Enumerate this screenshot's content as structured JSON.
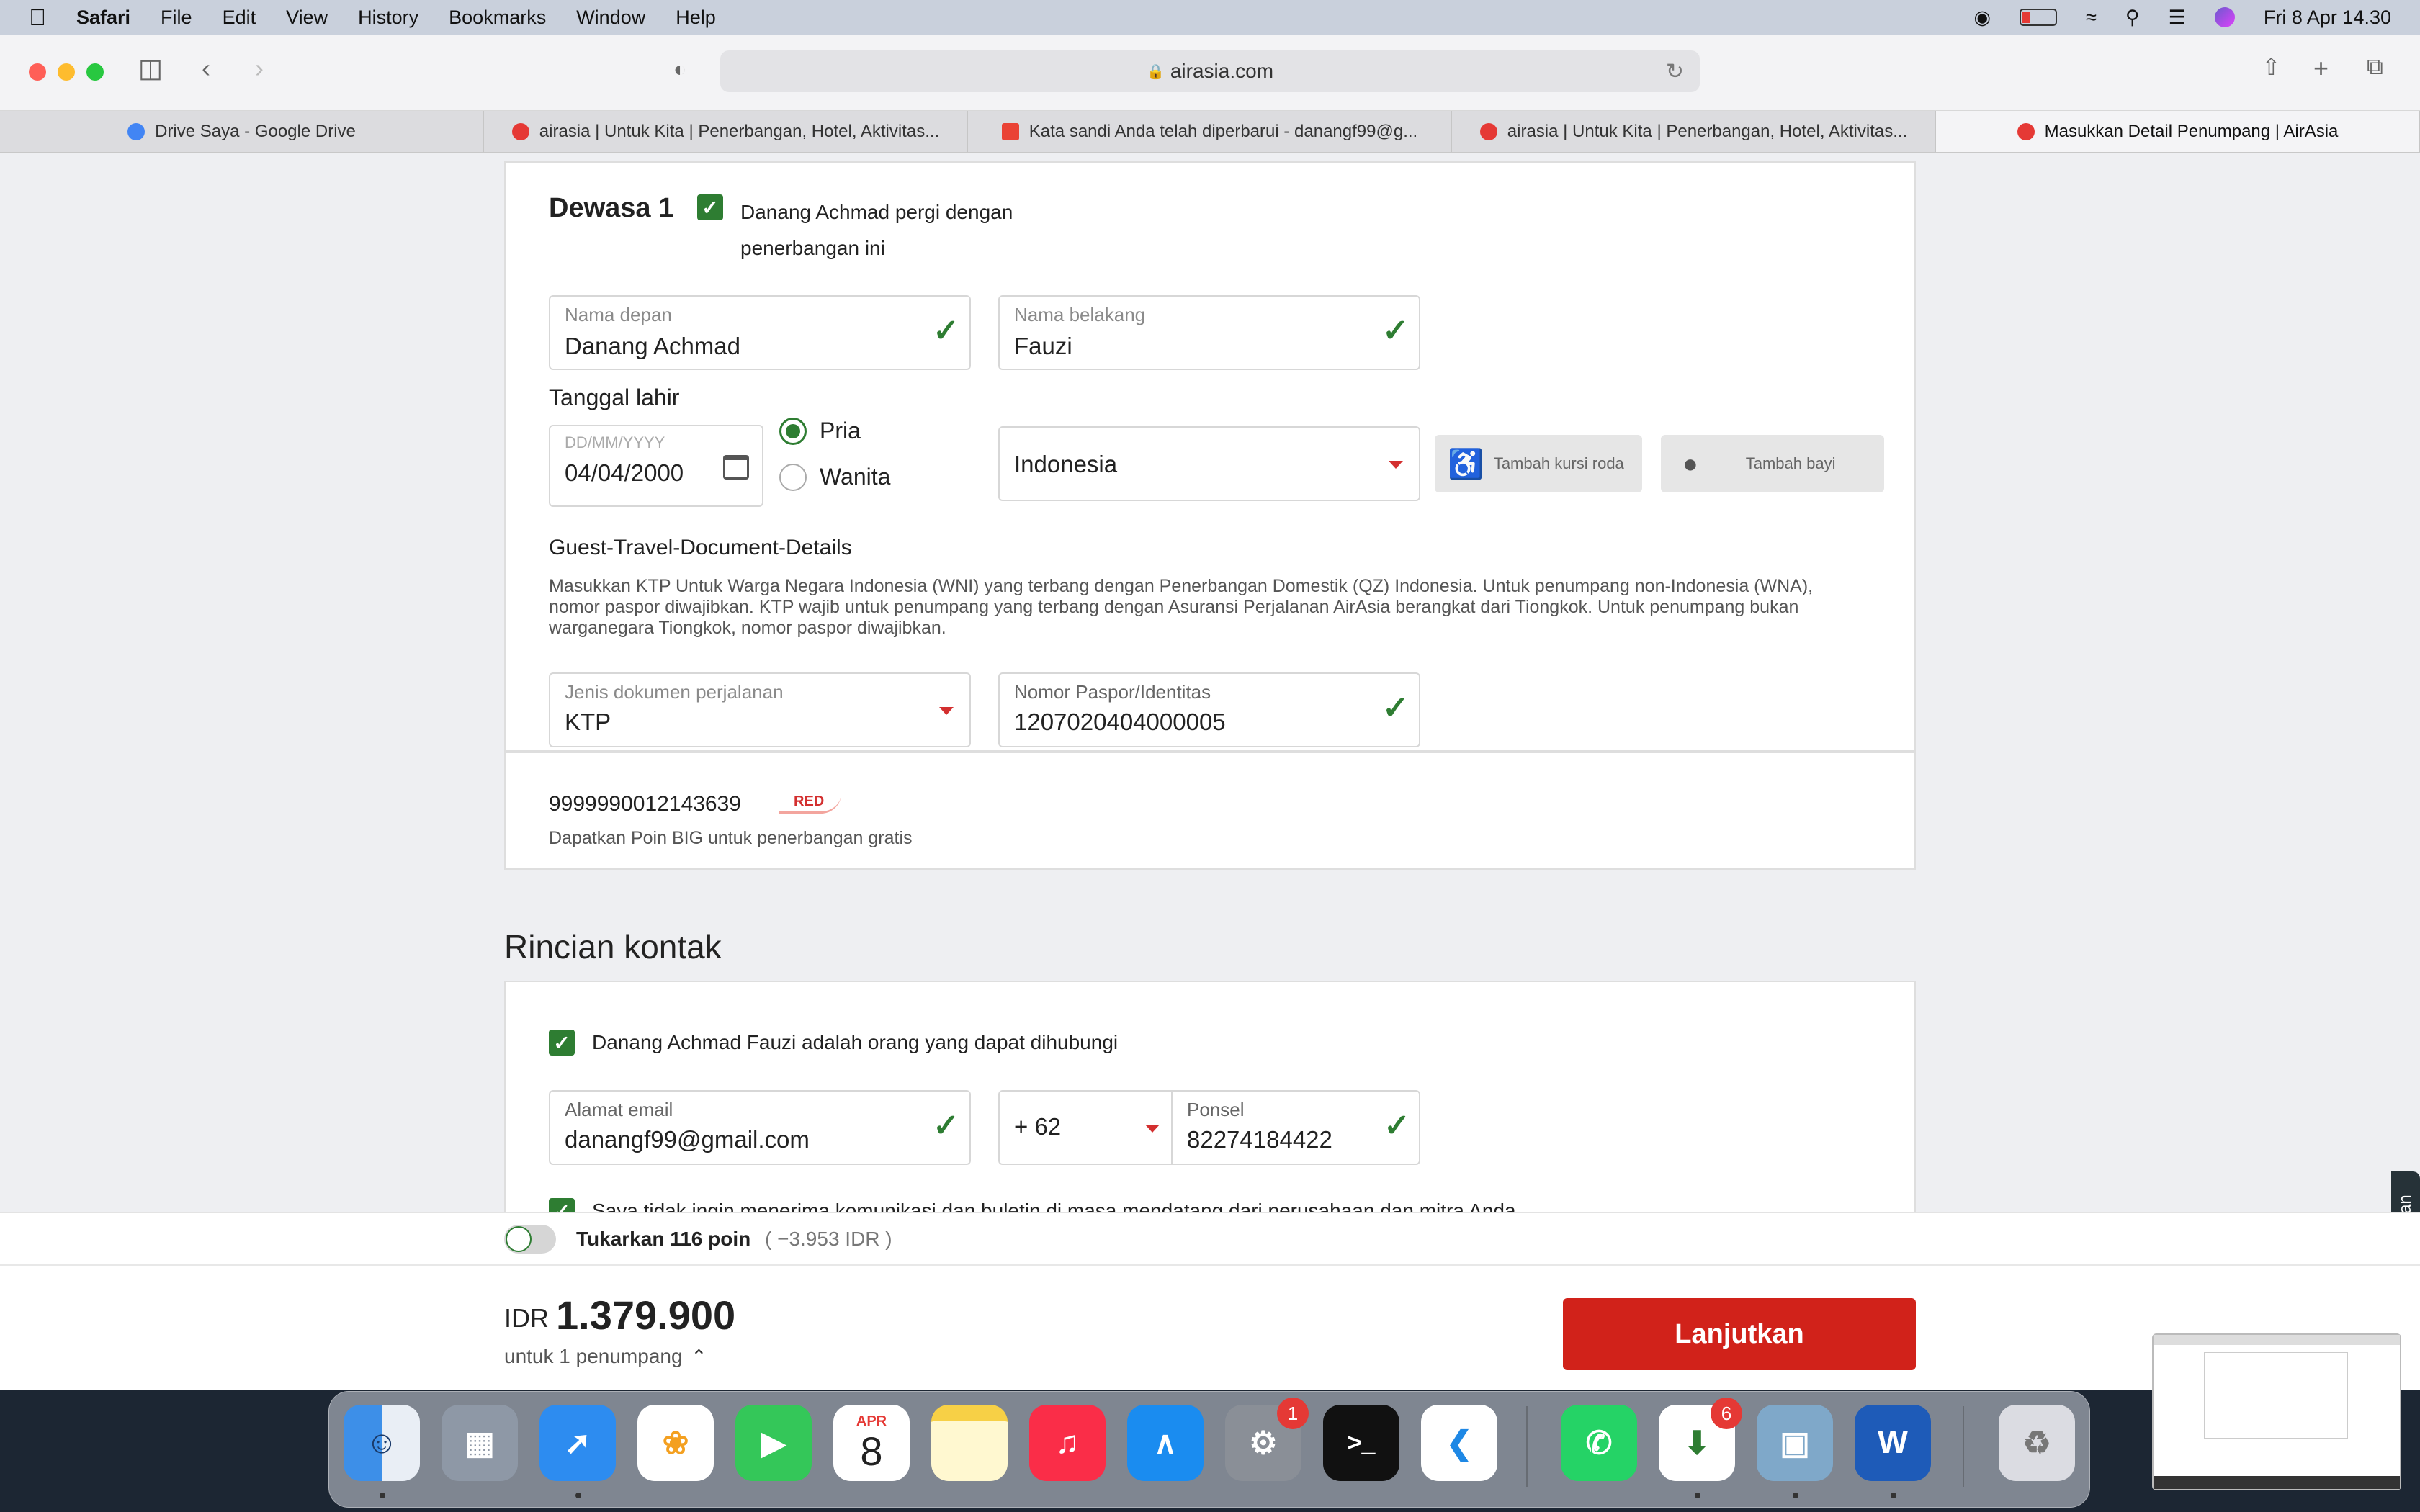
{
  "menubar": {
    "app": "Safari",
    "items": [
      "File",
      "Edit",
      "View",
      "History",
      "Bookmarks",
      "Window",
      "Help"
    ],
    "clock": "Fri 8 Apr  14.30"
  },
  "browser": {
    "url": "airasia.com",
    "tabs": [
      {
        "title": "Drive Saya - Google Drive",
        "color": "#4285f4"
      },
      {
        "title": "airasia | Untuk Kita | Penerbangan, Hotel, Aktivitas...",
        "color": "#e53935"
      },
      {
        "title": "Kata sandi Anda telah diperbarui - danangf99@g...",
        "color": "#ea4335"
      },
      {
        "title": "airasia | Untuk Kita | Penerbangan, Hotel, Aktivitas...",
        "color": "#e53935"
      },
      {
        "title": "Masukkan Detail Penumpang | AirAsia",
        "color": "#e53935"
      }
    ]
  },
  "passenger": {
    "heading": "Dewasa 1",
    "traveling_label_1": "Danang Achmad pergi dengan",
    "traveling_label_2": "penerbangan ini",
    "first_name_label": "Nama depan",
    "first_name": "Danang Achmad",
    "last_name_label": "Nama belakang",
    "last_name": "Fauzi",
    "dob_heading": "Tanggal lahir",
    "dob_placeholder": "DD/MM/YYYY",
    "dob": "04/04/2000",
    "gender_male": "Pria",
    "gender_female": "Wanita",
    "nationality": "Indonesia",
    "wheelchair_button": "Tambah kursi roda",
    "infant_button": "Tambah bayi",
    "doc_heading": "Guest-Travel-Document-Details",
    "doc_note": "Masukkan KTP Untuk Warga Negara Indonesia (WNI) yang terbang dengan Penerbangan Domestik (QZ) Indonesia. Untuk penumpang non-Indonesia (WNA), nomor paspor diwajibkan. KTP wajib untuk penumpang yang terbang dengan Asuransi Perjalanan AirAsia berangkat dari Tiongkok. Untuk penumpang bukan warganegara Tiongkok, nomor paspor diwajibkan.",
    "doc_type_label": "Jenis dokumen perjalanan",
    "doc_type": "KTP",
    "doc_number_label": "Nomor Paspor/Identitas",
    "doc_number": "1207020404000005",
    "member_id": "9999990012143639",
    "member_tier": "RED",
    "member_note": "Dapatkan Poin BIG untuk penerbangan gratis"
  },
  "contact": {
    "heading": "Rincian kontak",
    "contact_person": "Danang Achmad Fauzi adalah orang yang dapat dihubungi",
    "email_label": "Alamat email",
    "email": "danangf99@gmail.com",
    "country_code": "+ 62",
    "phone_label": "Ponsel",
    "phone": "82274184422",
    "optout": "Saya tidak ingin menerima komunikasi dan buletin di masa mendatang dari perusahaan dan mitra Anda"
  },
  "feedback_tab": "Tanggapan",
  "booking": {
    "points_label": "Tukarkan 116 poin",
    "points_value": "( −3.953 IDR )",
    "currency": "IDR",
    "price": "1.379.900",
    "per_pax": "untuk 1 penumpang",
    "cta": "Lanjutkan"
  },
  "dock": {
    "calendar_month": "APR",
    "calendar_day": "8",
    "settings_badge": "1",
    "installer_badge": "6",
    "terminal_glyph": ">_",
    "word_glyph": "W"
  }
}
